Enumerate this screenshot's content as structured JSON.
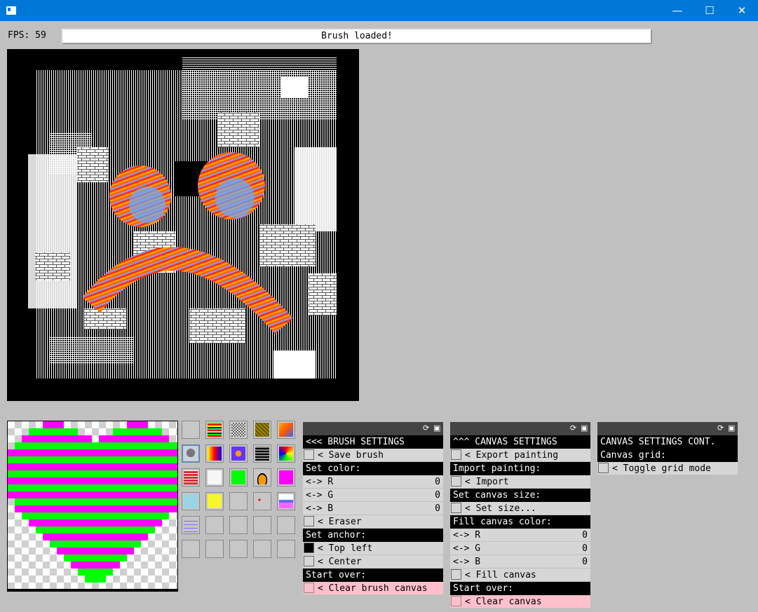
{
  "window": {
    "minimize": "—",
    "maximize": "☐",
    "close": "✕"
  },
  "fps_label": "FPS: 59",
  "status_text": "Brush loaded!",
  "colors": {
    "titlebar": "#0078d7",
    "magenta": "#ff00ff",
    "green": "#00ff00",
    "pink": "#ffc0cb"
  },
  "panels": [
    {
      "title": "<<< BRUSH SETTINGS",
      "rows": [
        {
          "type": "btn",
          "label": "< Save brush"
        },
        {
          "type": "hdr",
          "label": "Set color:"
        },
        {
          "type": "ch",
          "label": "<-> R",
          "value": "0"
        },
        {
          "type": "ch",
          "label": "<-> G",
          "value": "0"
        },
        {
          "type": "ch",
          "label": "<-> B",
          "value": "0"
        },
        {
          "type": "btn",
          "label": "< Eraser"
        },
        {
          "type": "hdr",
          "label": "Set anchor:"
        },
        {
          "type": "btn",
          "label": "< Top left",
          "box": "black"
        },
        {
          "type": "btn",
          "label": "< Center"
        },
        {
          "type": "hdr",
          "label": "Start over:"
        },
        {
          "type": "btn",
          "label": "< Clear brush canvas",
          "pink": true
        }
      ]
    },
    {
      "title": "^^^ CANVAS SETTINGS",
      "rows": [
        {
          "type": "btn",
          "label": "< Export painting"
        },
        {
          "type": "hdr",
          "label": "Import painting:"
        },
        {
          "type": "btn",
          "label": "< Import"
        },
        {
          "type": "hdr",
          "label": "Set canvas size:"
        },
        {
          "type": "btn",
          "label": "< Set size..."
        },
        {
          "type": "hdr",
          "label": "Fill canvas color:"
        },
        {
          "type": "ch",
          "label": "<-> R",
          "value": "0"
        },
        {
          "type": "ch",
          "label": "<-> G",
          "value": "0"
        },
        {
          "type": "ch",
          "label": "<-> B",
          "value": "0"
        },
        {
          "type": "btn",
          "label": "< Fill canvas"
        },
        {
          "type": "hdr",
          "label": "Start over:"
        },
        {
          "type": "btn",
          "label": "< Clear canvas",
          "pink": true
        }
      ]
    },
    {
      "title": "CANVAS SETTINGS CONT.",
      "rows": [
        {
          "type": "hdr",
          "label": "Canvas grid:"
        },
        {
          "type": "btn",
          "label": "< Toggle grid mode"
        }
      ]
    }
  ],
  "brush_slots": [
    "blank",
    "rainbow-stripes",
    "checker-gray",
    "brown-noise",
    "diagonal-rainbow",
    "heart",
    "rainbow-gradient",
    "rainbow-dots",
    "wave-black",
    "rainbow-x",
    "red-bricks",
    "white-noise",
    "green",
    "arch-orange",
    "magenta",
    "cyan-noise",
    "yellow-noise",
    "blank",
    "red-dots",
    "gradient-bar",
    "purple-lines",
    "blank",
    "blank",
    "blank",
    "blank",
    "blank",
    "blank",
    "blank",
    "blank",
    "blank"
  ]
}
